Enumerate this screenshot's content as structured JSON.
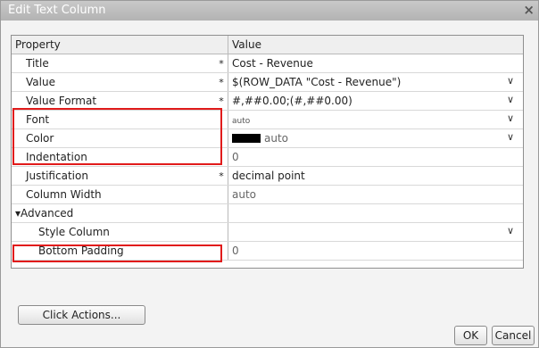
{
  "dialog": {
    "title": "Edit Text Column",
    "close_glyph": "×"
  },
  "grid": {
    "header": {
      "property": "Property",
      "value": "Value"
    },
    "rows": [
      {
        "property": "Title",
        "required": "*",
        "value": "Cost - Revenue",
        "dropdown": false
      },
      {
        "property": "Value",
        "required": "*",
        "value": "$(ROW_DATA \"Cost - Revenue\")",
        "dropdown": true
      },
      {
        "property": "Value Format",
        "required": "*",
        "value": "#,##0.00;(#,##0.00)",
        "dropdown": true
      },
      {
        "property": "Font",
        "required": "",
        "value": "auto",
        "dropdown": true
      },
      {
        "property": "Color",
        "required": "",
        "value": "auto",
        "dropdown": true
      },
      {
        "property": "Indentation",
        "required": "",
        "value": "0",
        "dropdown": false
      },
      {
        "property": "Justification",
        "required": "*",
        "value": "decimal point",
        "dropdown": false
      },
      {
        "property": "Column Width",
        "required": "",
        "value": "auto",
        "dropdown": false
      },
      {
        "property": "▾Advanced",
        "required": "",
        "value": "",
        "dropdown": false
      },
      {
        "property": "Style Column",
        "required": "",
        "value": "",
        "dropdown": true
      },
      {
        "property": "Bottom Padding",
        "required": "",
        "value": "0",
        "dropdown": false
      }
    ],
    "dropdown_glyph": "∨"
  },
  "buttons": {
    "click_actions": "Click Actions...",
    "ok": "OK",
    "cancel": "Cancel"
  },
  "colors": {
    "highlight": "#e11b1b",
    "color_swatch": "#000000"
  }
}
